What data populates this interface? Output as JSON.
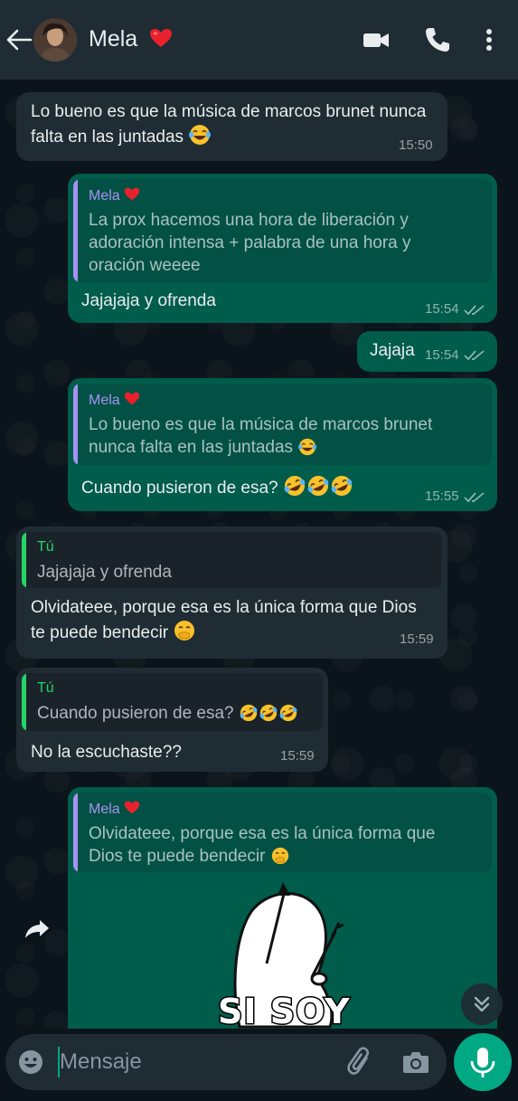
{
  "header": {
    "contact_name": "Mela",
    "heart": "❤️"
  },
  "messages": [
    {
      "text_line1": "Lo bueno es que la música de marcos brunet nunca",
      "text_line2": "falta en las juntadas",
      "time": "15:50"
    },
    {
      "quote_author": "Mela",
      "quote_line1": "La prox hacemos una hora de liberación y",
      "quote_line2": "adoración intensa + palabra de una hora y",
      "quote_line3": "oración weeee",
      "text": "Jajajaja y ofrenda",
      "time": "15:54"
    },
    {
      "text": "Jajaja",
      "time": "15:54"
    },
    {
      "quote_author": "Mela",
      "quote_line1": "Lo bueno es que la música de marcos brunet",
      "quote_line2": "nunca falta en las juntadas",
      "text": "Cuando pusieron de esa?",
      "time": "15:55"
    },
    {
      "quote_author": "Tú",
      "quote_line1": "Jajajaja y ofrenda",
      "text_line1": "Olvidateee, porque esa es la única forma que Dios",
      "text_line2": "te puede bendecir",
      "time": "15:59"
    },
    {
      "quote_author": "Tú",
      "quote_line1": "Cuando pusieron de esa?",
      "text": "No la escuchaste??",
      "time": "15:59"
    },
    {
      "quote_author": "Mela",
      "quote_line1": "Olvidateee, porque esa es la única forma que",
      "quote_line2": "Dios te puede bendecir",
      "sticker_text": "SI SOY"
    }
  ],
  "composer": {
    "placeholder": "Mensaje"
  },
  "colors": {
    "incoming": "#202c33",
    "outgoing": "#005c4b",
    "quote_author_mela": "#a791f5",
    "quote_author_tu": "#25d366",
    "accent": "#00a884",
    "tick": "#8696a0"
  },
  "icons": {
    "back": "arrow-left-icon",
    "video": "video-camera-icon",
    "call": "phone-icon",
    "menu": "more-vertical-icon",
    "emoji": "smiley-icon",
    "attach": "paperclip-icon",
    "camera": "camera-icon",
    "mic": "microphone-icon",
    "scroll": "chevron-double-down-icon",
    "forward": "forward-icon"
  }
}
